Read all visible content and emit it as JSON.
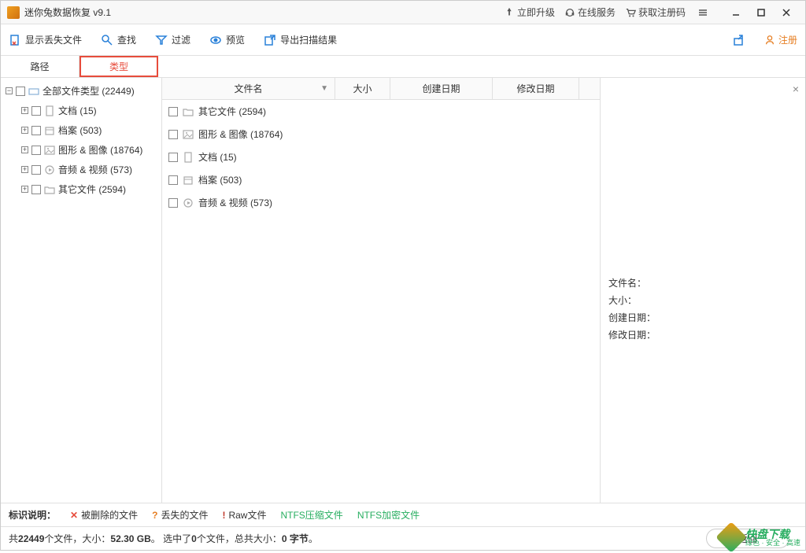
{
  "app": {
    "title": "迷你兔数据恢复 v9.1"
  },
  "titlebar_links": {
    "upgrade": "立即升级",
    "online": "在线服务",
    "getcode": "获取注册码"
  },
  "toolbar": {
    "show_lost": "显示丢失文件",
    "find": "查找",
    "filter": "过滤",
    "preview": "预览",
    "export": "导出扫描结果",
    "register": "注册"
  },
  "tabs": {
    "path": "路径",
    "type": "类型"
  },
  "tree": {
    "root": "全部文件类型 (22449)",
    "items": [
      {
        "label": "文档 (15)",
        "icon": "doc"
      },
      {
        "label": "档案 (503)",
        "icon": "archive"
      },
      {
        "label": "图形 & 图像 (18764)",
        "icon": "image"
      },
      {
        "label": "音频 & 视频 (573)",
        "icon": "media"
      },
      {
        "label": "其它文件 (2594)",
        "icon": "folder"
      }
    ]
  },
  "list": {
    "columns": {
      "name": "文件名",
      "size": "大小",
      "cdate": "创建日期",
      "mdate": "修改日期"
    },
    "rows": [
      {
        "label": "其它文件 (2594)",
        "icon": "folder"
      },
      {
        "label": "图形 & 图像 (18764)",
        "icon": "image"
      },
      {
        "label": "文档 (15)",
        "icon": "doc"
      },
      {
        "label": "档案 (503)",
        "icon": "archive"
      },
      {
        "label": "音频 & 视频 (573)",
        "icon": "media"
      }
    ]
  },
  "preview": {
    "fname": "文件名：",
    "fsize": "大小：",
    "fcdate": "创建日期：",
    "fmdate": "修改日期："
  },
  "legend": {
    "label": "标识说明：",
    "deleted": "被删除的文件",
    "lost": "丢失的文件",
    "raw": "Raw文件",
    "ntfs_comp": "NTFS压缩文件",
    "ntfs_enc": "NTFS加密文件"
  },
  "status": {
    "text_parts": {
      "p1": "共",
      "p2": "22449",
      "p3": "个文件，大小：",
      "p4": "52.30 GB",
      "p5": "。  选中了",
      "p6": "0",
      "p7": "个文件，总共大小：",
      "p8": "0 字节",
      "p9": "。"
    },
    "back": "返回"
  },
  "watermark": {
    "main": "快盘下载",
    "sub": "绿色 · 安全 · 高速"
  }
}
